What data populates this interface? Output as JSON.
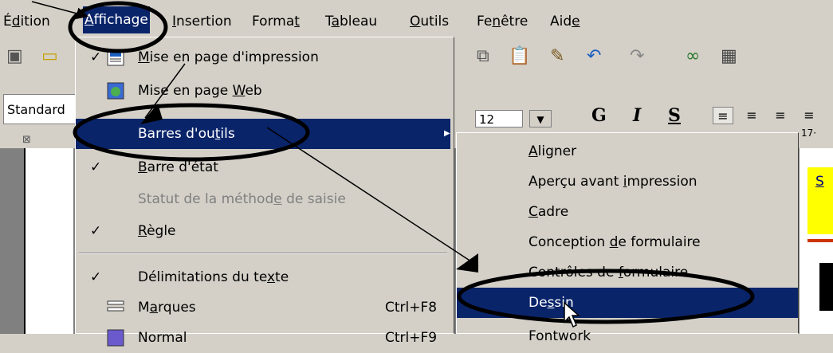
{
  "menubar": {
    "items": [
      {
        "label": "Édition",
        "underline": "d",
        "pre": "É",
        "post": "ition"
      },
      {
        "label": "Affichage",
        "pre": "",
        "underline": "A",
        "post": "ffichage"
      },
      {
        "label": "Insertion",
        "pre": "",
        "underline": "I",
        "post": "nsertion"
      },
      {
        "label": "Format",
        "pre": "Forma",
        "underline": "t",
        "post": ""
      },
      {
        "label": "Tableau",
        "pre": "T",
        "underline": "a",
        "post": "bleau"
      },
      {
        "label": "Outils",
        "pre": "",
        "underline": "O",
        "post": "utils"
      },
      {
        "label": "Fenêtre",
        "pre": "Fe",
        "underline": "n",
        "post": "être"
      },
      {
        "label": "Aide",
        "pre": "Aid",
        "underline": "e",
        "post": ""
      }
    ]
  },
  "toolbar": {
    "style_value": "Standard",
    "size_value": "12",
    "bold_label": "G",
    "italic_label": "I",
    "underline_label": "S"
  },
  "ruler": {
    "number": "17·"
  },
  "doc": {
    "underlined_text": "S"
  },
  "menu": {
    "items": [
      {
        "pre": "",
        "u": "M",
        "post": "ise en page d'impression",
        "check": "✓",
        "icon": "print-layout-icon"
      },
      {
        "pre": "Mise en page ",
        "u": "W",
        "post": "eb",
        "check": "",
        "icon": "web-layout-icon"
      },
      {
        "pre": "Barres d'ou",
        "u": "t",
        "post": "ils",
        "check": "",
        "arrow": "▶"
      },
      {
        "pre": "",
        "u": "B",
        "post": "arre d'état",
        "check": "✓"
      },
      {
        "pre": "Statut de la méthod",
        "u": "e",
        "post": " de saisie",
        "check": ""
      },
      {
        "pre": "",
        "u": "R",
        "post": "ègle",
        "check": "✓"
      },
      {
        "pre": "Délimitations du te",
        "u": "x",
        "post": "te",
        "check": "✓"
      },
      {
        "pre": "M",
        "u": "a",
        "post": "rques",
        "check": "",
        "shortcut": "Ctrl+F8",
        "icon": "bookmarks-icon"
      },
      {
        "pre": "Normal",
        "u": "",
        "post": "",
        "check": "",
        "shortcut": "Ctrl+F9"
      }
    ]
  },
  "submenu": {
    "items": [
      {
        "pre": "",
        "u": "A",
        "post": "ligner"
      },
      {
        "pre": "Aperçu avant ",
        "u": "i",
        "post": "mpression"
      },
      {
        "pre": "",
        "u": "C",
        "post": "adre"
      },
      {
        "pre": "Conception ",
        "u": "d",
        "post": "e formulaire"
      },
      {
        "pre": "Contrôles de ",
        "u": "f",
        "post": "ormulaire"
      },
      {
        "pre": "De",
        "u": "s",
        "post": "sin"
      },
      {
        "pre": "Fontwork",
        "u": "",
        "post": ""
      }
    ]
  },
  "colors": {
    "highlight": "#0a246a",
    "face": "#d4d0c8"
  }
}
